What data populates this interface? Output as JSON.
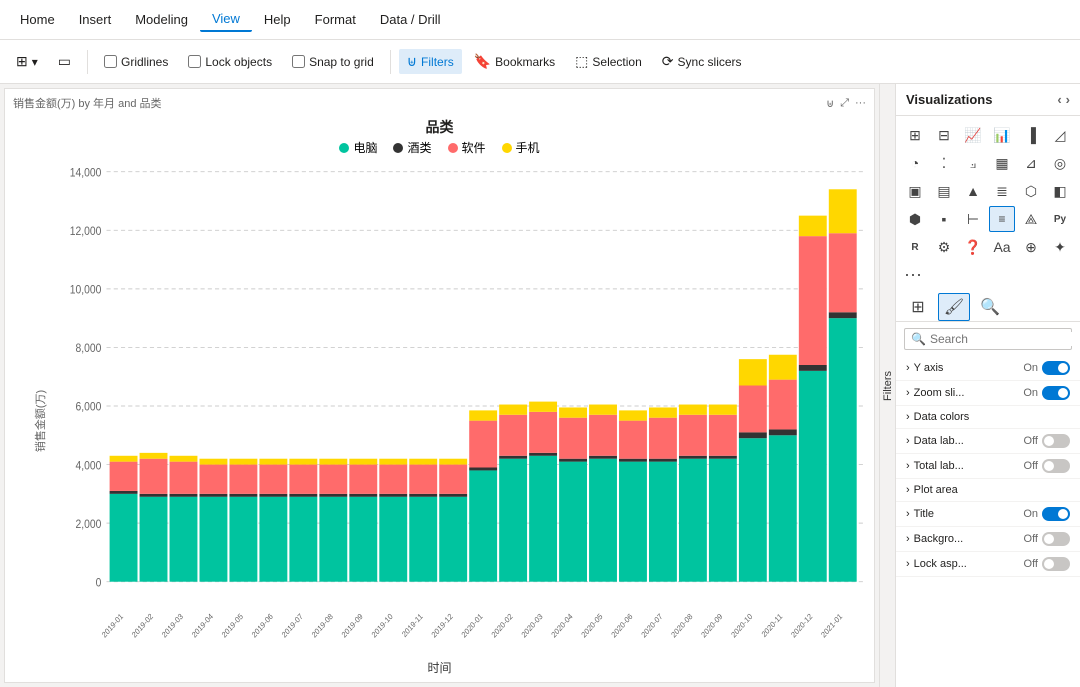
{
  "menu": {
    "items": [
      {
        "label": "Home",
        "active": false
      },
      {
        "label": "Insert",
        "active": false
      },
      {
        "label": "Modeling",
        "active": false
      },
      {
        "label": "View",
        "active": true
      },
      {
        "label": "Help",
        "active": false
      },
      {
        "label": "Format",
        "active": false
      },
      {
        "label": "Data / Drill",
        "active": false
      }
    ]
  },
  "toolbar": {
    "page_view_icon": "⊞",
    "mobile_icon": "📱",
    "gridlines_label": "Gridlines",
    "lock_objects_label": "Lock objects",
    "snap_to_grid_label": "Snap to grid",
    "filters_label": "Filters",
    "bookmarks_label": "Bookmarks",
    "selection_label": "Selection",
    "sync_slicers_label": "Sync slicers"
  },
  "chart": {
    "title_text": "销售金额(万) by 年月 and 品类",
    "category_label": "品类",
    "legend": [
      {
        "label": "电脑",
        "color": "#00c49f"
      },
      {
        "label": "酒类",
        "color": "#333333"
      },
      {
        "label": "软件",
        "color": "#ff6b6b"
      },
      {
        "label": "手机",
        "color": "#ffd700"
      }
    ],
    "y_axis_label": "销售金额(万)",
    "x_axis_label": "时间",
    "y_ticks": [
      "0",
      "2,000",
      "4,000",
      "6,000",
      "8,000",
      "10,000",
      "12,000",
      "14,000"
    ],
    "x_labels": [
      "2019-01",
      "2019-02",
      "2019-03",
      "2019-04",
      "2019-05",
      "2019-06",
      "2019-07",
      "2019-08",
      "2019-09",
      "2019-10",
      "2019-11",
      "2019-12",
      "2020-01",
      "2020-02",
      "2020-03",
      "2020-04",
      "2020-05",
      "2020-06",
      "2020-07",
      "2020-08",
      "2020-09",
      "2020-10",
      "2020-11",
      "2020-12",
      "2021-01"
    ],
    "bars": [
      {
        "diannao": 3000,
        "jiulei": 100,
        "ruanjian": 1000,
        "shouji": 200
      },
      {
        "diannao": 2900,
        "jiulei": 100,
        "ruanjian": 1200,
        "shouji": 200
      },
      {
        "diannao": 2900,
        "jiulei": 100,
        "ruanjian": 1100,
        "shouji": 200
      },
      {
        "diannao": 2900,
        "jiulei": 100,
        "ruanjian": 1000,
        "shouji": 200
      },
      {
        "diannao": 2900,
        "jiulei": 100,
        "ruanjian": 1000,
        "shouji": 200
      },
      {
        "diannao": 2900,
        "jiulei": 100,
        "ruanjian": 1000,
        "shouji": 200
      },
      {
        "diannao": 2900,
        "jiulei": 100,
        "ruanjian": 1000,
        "shouji": 200
      },
      {
        "diannao": 2900,
        "jiulei": 100,
        "ruanjian": 1000,
        "shouji": 200
      },
      {
        "diannao": 2900,
        "jiulei": 100,
        "ruanjian": 1000,
        "shouji": 200
      },
      {
        "diannao": 2900,
        "jiulei": 100,
        "ruanjian": 1000,
        "shouji": 200
      },
      {
        "diannao": 2900,
        "jiulei": 100,
        "ruanjian": 1000,
        "shouji": 200
      },
      {
        "diannao": 2900,
        "jiulei": 100,
        "ruanjian": 1000,
        "shouji": 200
      },
      {
        "diannao": 3800,
        "jiulei": 100,
        "ruanjian": 1600,
        "shouji": 350
      },
      {
        "diannao": 4200,
        "jiulei": 100,
        "ruanjian": 1400,
        "shouji": 350
      },
      {
        "diannao": 4300,
        "jiulei": 100,
        "ruanjian": 1400,
        "shouji": 350
      },
      {
        "diannao": 4100,
        "jiulei": 100,
        "ruanjian": 1400,
        "shouji": 350
      },
      {
        "diannao": 4200,
        "jiulei": 100,
        "ruanjian": 1400,
        "shouji": 350
      },
      {
        "diannao": 4100,
        "jiulei": 100,
        "ruanjian": 1300,
        "shouji": 350
      },
      {
        "diannao": 4100,
        "jiulei": 100,
        "ruanjian": 1400,
        "shouji": 350
      },
      {
        "diannao": 4200,
        "jiulei": 100,
        "ruanjian": 1400,
        "shouji": 350
      },
      {
        "diannao": 4200,
        "jiulei": 100,
        "ruanjian": 1400,
        "shouji": 350
      },
      {
        "diannao": 4900,
        "jiulei": 200,
        "ruanjian": 1600,
        "shouji": 900
      },
      {
        "diannao": 5000,
        "jiulei": 200,
        "ruanjian": 1700,
        "shouji": 850
      },
      {
        "diannao": 7200,
        "jiulei": 200,
        "ruanjian": 4400,
        "shouji": 700
      },
      {
        "diannao": 9000,
        "jiulei": 200,
        "ruanjian": 2700,
        "shouji": 1500
      }
    ]
  },
  "visualizations_panel": {
    "title": "Visualizations",
    "search_placeholder": "Search",
    "properties": [
      {
        "label": "Y axis",
        "control": "toggle",
        "state": "on"
      },
      {
        "label": "Zoom sli...",
        "control": "toggle",
        "state": "on"
      },
      {
        "label": "Data colors",
        "control": "expand",
        "state": null
      },
      {
        "label": "Data lab...",
        "control": "toggle",
        "state": "off"
      },
      {
        "label": "Total lab...",
        "control": "toggle",
        "state": "off"
      },
      {
        "label": "Plot area",
        "control": "expand",
        "state": null
      },
      {
        "label": "Title",
        "control": "toggle",
        "state": "on"
      },
      {
        "label": "Backgro...",
        "control": "toggle",
        "state": "off"
      },
      {
        "label": "Lock asp...",
        "control": "toggle",
        "state": "off"
      }
    ]
  },
  "filters_panel": {
    "label": "Filters"
  }
}
